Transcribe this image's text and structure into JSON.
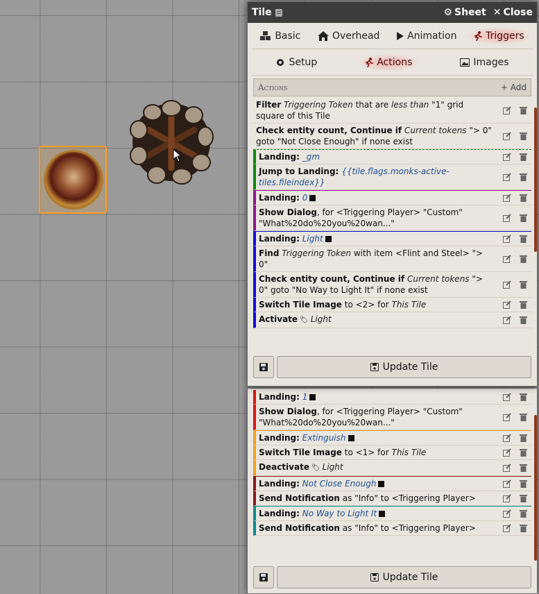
{
  "window": {
    "title": "Tile",
    "sheet_label": "Sheet",
    "close_label": "Close"
  },
  "tabs_primary": [
    {
      "label": "Basic",
      "icon": "cubes-icon"
    },
    {
      "label": "Overhead",
      "icon": "house-icon"
    },
    {
      "label": "Animation",
      "icon": "play-icon"
    },
    {
      "label": "Triggers",
      "icon": "running-icon",
      "active": true
    }
  ],
  "tabs_secondary": [
    {
      "label": "Setup",
      "icon": "gear-icon"
    },
    {
      "label": "Actions",
      "icon": "running-icon",
      "active": true
    },
    {
      "label": "Images",
      "icon": "image-icon"
    }
  ],
  "actions_header": {
    "title": "Actions",
    "add_label": "+ Add"
  },
  "colors": {
    "green": "#0a8a10",
    "purple": "#8a1a8a",
    "blue": "#1010d8",
    "red": "#d81818",
    "orange": "#f0a020",
    "darkred": "#8b1a1a",
    "teal": "#108a8a",
    "scroll": "#8b3a1a"
  },
  "rows_top": [
    {
      "parts": [
        [
          "b",
          "Filter"
        ],
        [
          "t",
          " "
        ],
        [
          "i",
          "Triggering Token"
        ],
        [
          "t",
          " that are "
        ],
        [
          "i",
          "less than"
        ],
        [
          "t",
          " \"1\" grid square of this Tile"
        ]
      ]
    },
    {
      "parts": [
        [
          "b",
          "Check entity count, Continue if"
        ],
        [
          "t",
          " "
        ],
        [
          "i",
          "Current tokens"
        ],
        [
          "t",
          " \"> 0\" goto \"Not Close Enough\" if none exist"
        ]
      ]
    },
    {
      "parts": [
        [
          "b",
          "Landing:"
        ],
        [
          "t",
          " "
        ],
        [
          "l",
          "_gm"
        ]
      ],
      "color": "green",
      "top": "dashed"
    },
    {
      "parts": [
        [
          "b",
          "Jump to Landing:"
        ],
        [
          "t",
          " "
        ],
        [
          "l",
          "{{tile.flags.monks-active-tiles.fileindex}}"
        ]
      ],
      "color": "green"
    },
    {
      "parts": [
        [
          "b",
          "Landing:"
        ],
        [
          "t",
          " "
        ],
        [
          "l",
          "0"
        ]
      ],
      "sq": true,
      "color": "purple",
      "top": "solid"
    },
    {
      "parts": [
        [
          "b",
          "Show Dialog"
        ],
        [
          "t",
          ", for <Triggering Player> \"Custom\" \"What%20do%20you%20wan...\""
        ]
      ],
      "color": "purple"
    },
    {
      "parts": [
        [
          "b",
          "Landing:"
        ],
        [
          "t",
          " "
        ],
        [
          "l",
          "Light"
        ]
      ],
      "sq": true,
      "color": "blue",
      "top": "solid"
    },
    {
      "parts": [
        [
          "b",
          "Find"
        ],
        [
          "t",
          " "
        ],
        [
          "i",
          "Triggering Token"
        ],
        [
          "t",
          " with item <Flint and Steel> \"> 0\""
        ]
      ],
      "color": "blue"
    },
    {
      "parts": [
        [
          "b",
          "Check entity count, Continue if"
        ],
        [
          "t",
          " "
        ],
        [
          "i",
          "Current tokens"
        ],
        [
          "t",
          " \"> 0\" goto \"No Way to Light It\" if none exist"
        ]
      ],
      "color": "blue"
    },
    {
      "parts": [
        [
          "b",
          "Switch Tile Image"
        ],
        [
          "t",
          " to <2> for "
        ],
        [
          "i",
          "This Tile"
        ]
      ],
      "color": "blue"
    },
    {
      "parts": [
        [
          "b",
          "Activate"
        ],
        [
          "g",
          "🏷"
        ],
        [
          "i",
          "Light"
        ]
      ],
      "color": "blue"
    }
  ],
  "rows_bottom": [
    {
      "parts": [
        [
          "b",
          "Landing:"
        ],
        [
          "t",
          " "
        ],
        [
          "l",
          "1"
        ]
      ],
      "sq": true,
      "color": "red"
    },
    {
      "parts": [
        [
          "b",
          "Show Dialog"
        ],
        [
          "t",
          ", for <Triggering Player> \"Custom\" \"What%20do%20you%20wan...\""
        ]
      ],
      "color": "red"
    },
    {
      "parts": [
        [
          "b",
          "Landing:"
        ],
        [
          "t",
          " "
        ],
        [
          "l",
          "Extinguish"
        ]
      ],
      "sq": true,
      "color": "orange",
      "top": "solid"
    },
    {
      "parts": [
        [
          "b",
          "Switch Tile Image"
        ],
        [
          "t",
          " to <1> for "
        ],
        [
          "i",
          "This Tile"
        ]
      ],
      "color": "orange"
    },
    {
      "parts": [
        [
          "b",
          "Deactivate"
        ],
        [
          "g",
          "🏷"
        ],
        [
          "i",
          "Light"
        ]
      ],
      "color": "orange"
    },
    {
      "parts": [
        [
          "b",
          "Landing:"
        ],
        [
          "t",
          " "
        ],
        [
          "l",
          "Not Close Enough"
        ]
      ],
      "sq": true,
      "color": "darkred",
      "top": "solid"
    },
    {
      "parts": [
        [
          "b",
          "Send Notification"
        ],
        [
          "t",
          " as \"Info\" to <Triggering Player>"
        ]
      ],
      "color": "darkred"
    },
    {
      "parts": [
        [
          "b",
          "Landing:"
        ],
        [
          "t",
          " "
        ],
        [
          "l",
          "No Way to Light It"
        ]
      ],
      "sq": true,
      "color": "teal",
      "top": "solid"
    },
    {
      "parts": [
        [
          "b",
          "Send Notification"
        ],
        [
          "t",
          " as \"Info\" to <Triggering Player>"
        ]
      ],
      "color": "teal"
    }
  ],
  "footer": {
    "update_label": "Update Tile"
  }
}
